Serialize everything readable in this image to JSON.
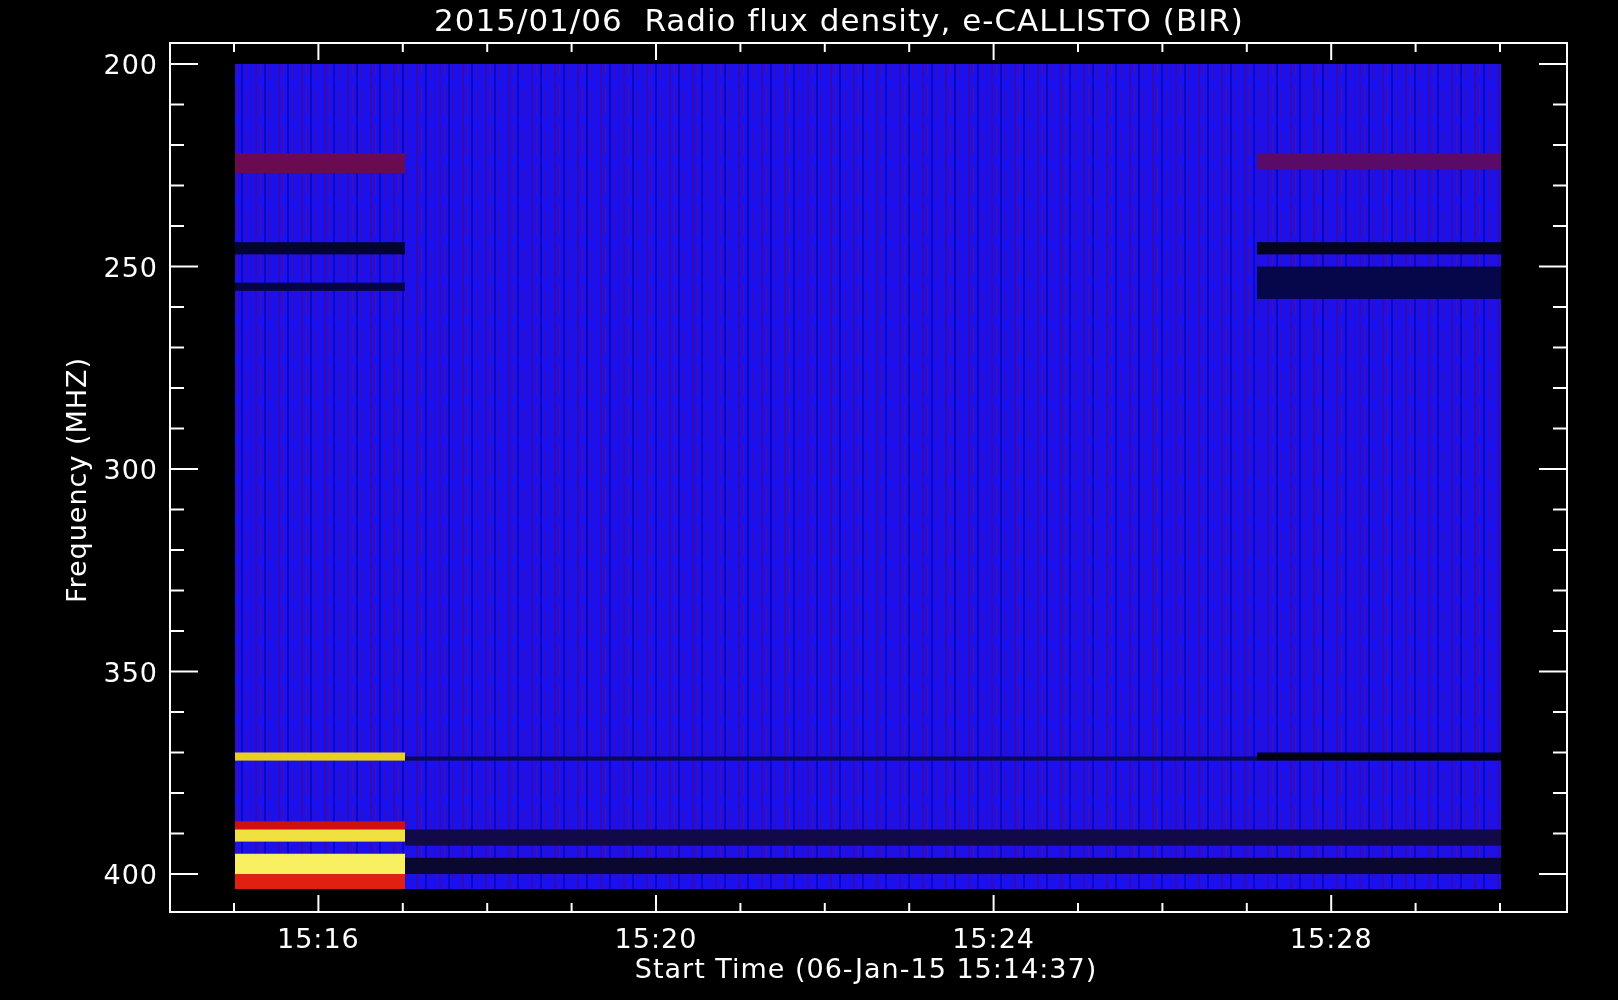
{
  "title": "2015/01/06  Radio flux density, e-CALLISTO (BIR)",
  "y_axis": {
    "label": "Frequency (MHZ)",
    "ticks": [
      "200",
      "250",
      "300",
      "350",
      "400"
    ]
  },
  "x_axis": {
    "label": "Start Time (06-Jan-15 15:14:37)",
    "ticks": [
      "15:16",
      "15:20",
      "15:24",
      "15:28"
    ]
  }
}
